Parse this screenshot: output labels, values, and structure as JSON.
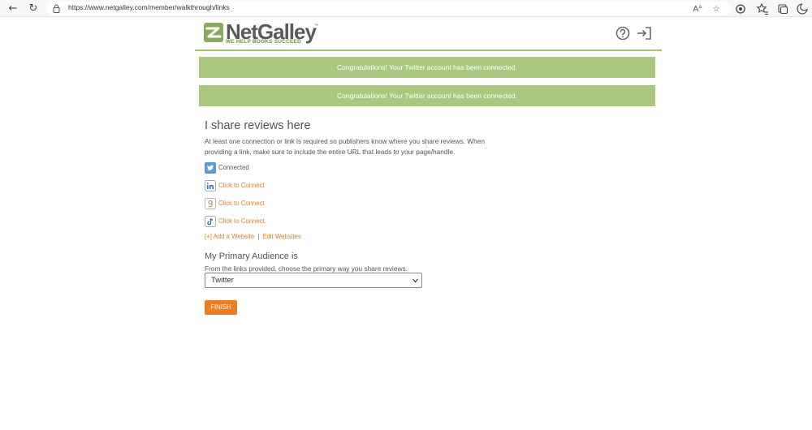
{
  "browser": {
    "url": "https://www.netgalley.com/member/walkthrough/links",
    "back_glyph": "←",
    "refresh_glyph": "↻",
    "read_aloud_glyph": "Aᴬ",
    "favorite_glyph": "☆"
  },
  "header": {
    "logo_name": "NetGalley",
    "logo_tm": "™",
    "logo_tagline": "WE HELP BOOKS SUCCEED"
  },
  "alerts": [
    "Congratulations! Your Twitter account has been connected.",
    "Congratulations! Your Twitter account has been connected."
  ],
  "section": {
    "title": "I share reviews here",
    "description": "At least one connection or link is required so publishers know where you share reviews. When providing a link, make sure to include the entire URL that leads to your page/handle."
  },
  "socials": {
    "twitter": {
      "label": "Connected",
      "icon": "twitter-icon"
    },
    "linkedin": {
      "label": "Click to Connect",
      "icon": "linkedin-icon"
    },
    "goodreads": {
      "label": "Click to Connect",
      "icon": "goodreads-icon"
    },
    "tiktok": {
      "label": "Click to Connect",
      "icon": "tiktok-icon"
    }
  },
  "websites": {
    "add_label": "[+] Add a Website",
    "separator": "|",
    "edit_label": "Edit Websites"
  },
  "audience": {
    "title": "My Primary Audience is",
    "description": "From the links provided, choose the primary way you share reviews.",
    "selected": "Twitter"
  },
  "finish_label": "FINISH",
  "colors": {
    "brand_green": "#abc880",
    "accent_orange": "#f07b22",
    "link_orange": "#e67e22"
  }
}
